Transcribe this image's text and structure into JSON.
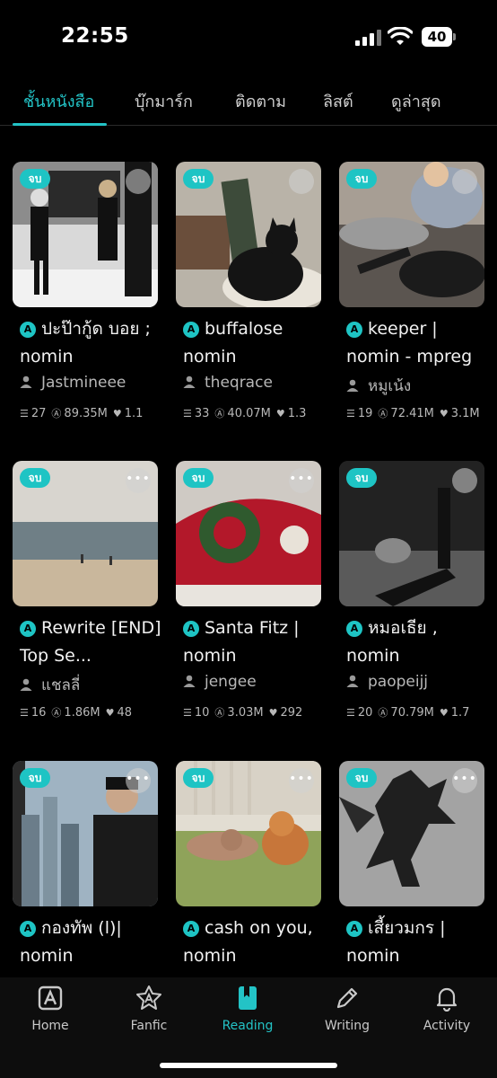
{
  "status": {
    "time": "22:55",
    "battery": "40"
  },
  "tabs": [
    {
      "label": "ชั้นหนังสือ",
      "active": true
    },
    {
      "label": "บุ๊กมาร์ก",
      "active": false
    },
    {
      "label": "ติดตาม",
      "active": false
    },
    {
      "label": "ลิสต์",
      "active": false
    },
    {
      "label": "ดูล่าสุด",
      "active": false
    }
  ],
  "badge_label": "จบ",
  "more_label": "•••",
  "a_icon": "A",
  "cards": [
    {
      "title": "ปะป๊ากู้ด บอย ; nomin",
      "author": "Jastmineee",
      "chapters": "27",
      "views": "89.35M",
      "likes": "1.1"
    },
    {
      "title": "buffalose nomin",
      "author": "theqrace",
      "chapters": "33",
      "views": "40.07M",
      "likes": "1.3"
    },
    {
      "title": "keeper | nomin - mpreg",
      "author": "หมูเน้ง",
      "chapters": "19",
      "views": "72.41M",
      "likes": "3.1M"
    },
    {
      "title": "Rewrite [END] Top Se...",
      "author": "แชลลี่",
      "chapters": "16",
      "views": "1.86M",
      "likes": "48"
    },
    {
      "title": "Santa Fitz | nomin",
      "author": "jengee",
      "chapters": "10",
      "views": "3.03M",
      "likes": "292"
    },
    {
      "title": "หมอเธีย , nomin",
      "author": "paopeijj",
      "chapters": "20",
      "views": "70.79M",
      "likes": "1.7"
    },
    {
      "title": "กองทัพ (l)| nomin",
      "author": "",
      "chapters": "",
      "views": "",
      "likes": ""
    },
    {
      "title": "cash on you, nomin",
      "author": "",
      "chapters": "",
      "views": "",
      "likes": ""
    },
    {
      "title": "เสี้ยวมกร | nomin",
      "author": "",
      "chapters": "",
      "views": "",
      "likes": ""
    }
  ],
  "nav": [
    {
      "label": "Home",
      "icon": "home-a-icon"
    },
    {
      "label": "Fanfic",
      "icon": "fanfic-star-icon"
    },
    {
      "label": "Reading",
      "icon": "bookmark-book-icon",
      "active": true
    },
    {
      "label": "Writing",
      "icon": "pencil-icon"
    },
    {
      "label": "Activity",
      "icon": "bell-icon"
    }
  ],
  "colors": {
    "accent": "#23c3c6",
    "background": "#000000"
  }
}
